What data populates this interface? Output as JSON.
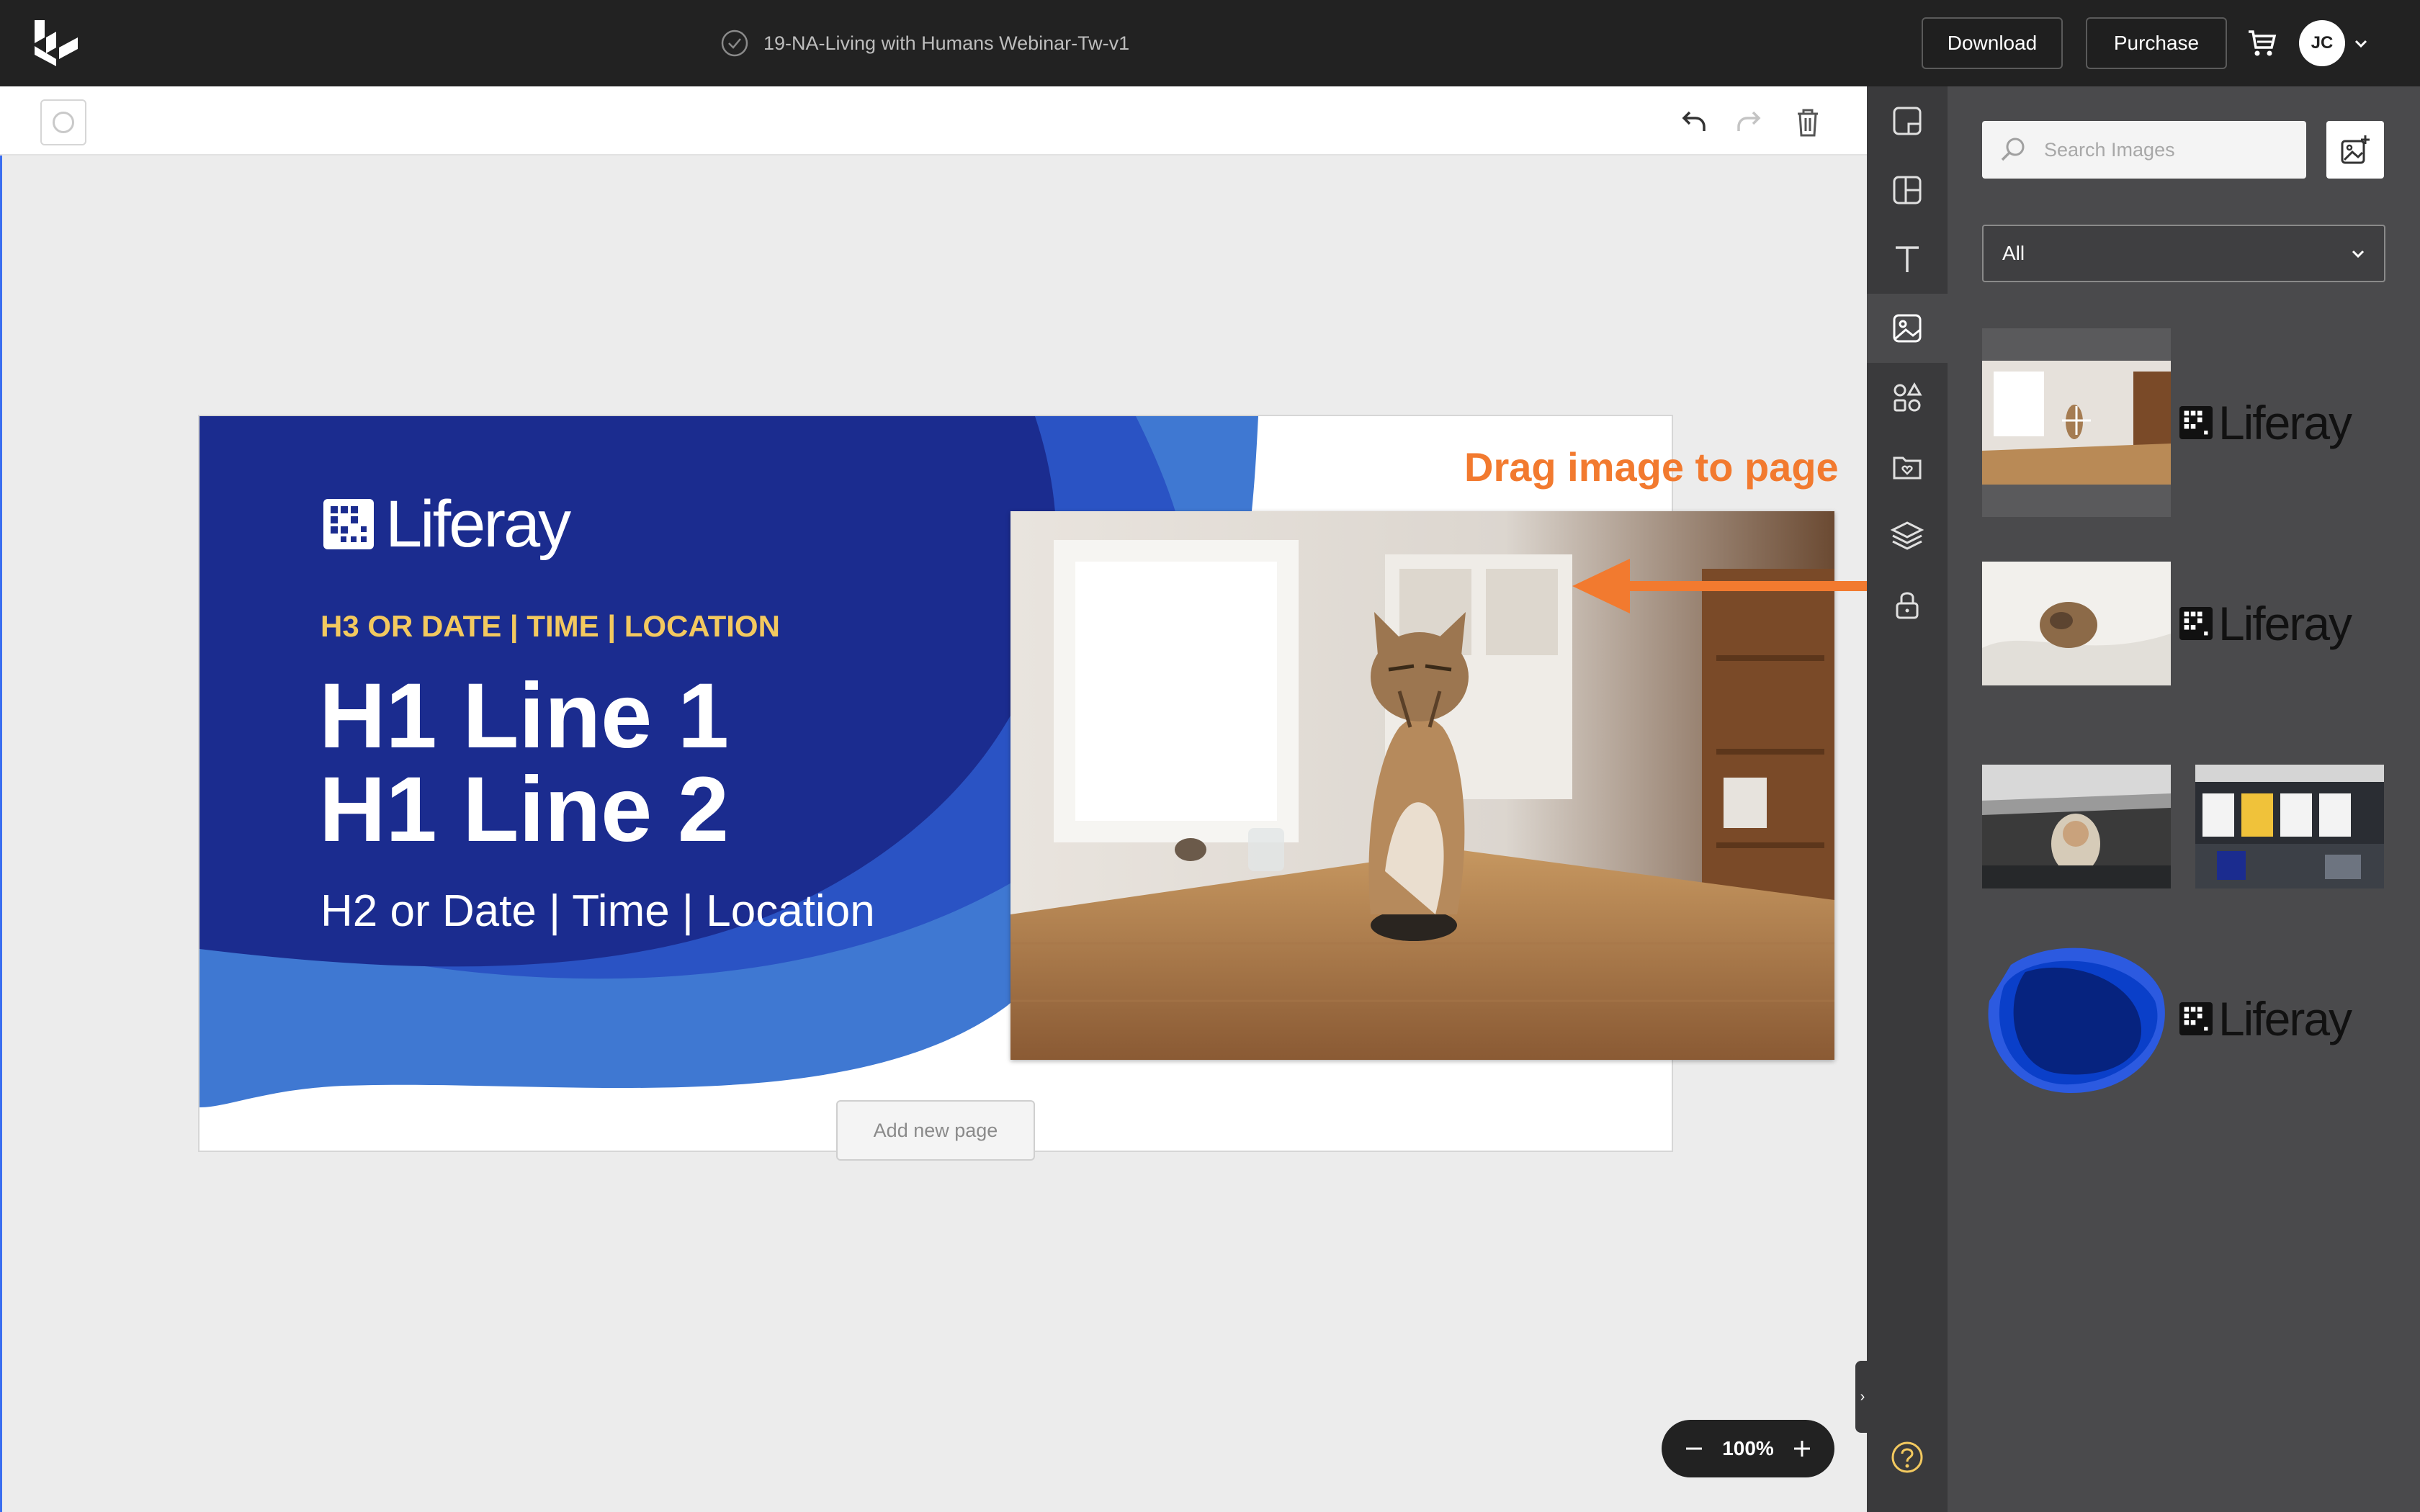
{
  "app": {
    "document_title": "19-NA-Living with Humans Webinar-Tw-v1",
    "download_label": "Download",
    "purchase_label": "Purchase",
    "user_initials": "JC"
  },
  "design": {
    "brand_name": "Liferay",
    "h3_text": "H3 OR DATE | TIME | LOCATION",
    "h1_line1": "H1 Line 1",
    "h1_line2": "H1 Line 2",
    "h2_text": "H2 or Date | Time | Location",
    "annotation": "Drag image to page"
  },
  "canvas": {
    "add_page_label": "Add new page",
    "zoom_level": "100%"
  },
  "images_panel": {
    "search_placeholder": "Search Images",
    "filter_selected": "All",
    "thumbnails": [
      {
        "name": "kitchen-cat",
        "label": ""
      },
      {
        "name": "liferay-logo",
        "label": "Liferay"
      },
      {
        "name": "sleeping-cat",
        "label": ""
      },
      {
        "name": "liferay-logo",
        "label": "Liferay"
      },
      {
        "name": "worker-overhead",
        "label": ""
      },
      {
        "name": "office-space",
        "label": ""
      },
      {
        "name": "blue-blob",
        "label": ""
      },
      {
        "name": "liferay-logo",
        "label": "Liferay"
      }
    ]
  },
  "colors": {
    "brand_blue": "#1b2c8f",
    "mid_blue": "#2f5bd0",
    "light_blue": "#4a7bd6",
    "accent_yellow": "#f3c95f",
    "annotation_orange": "#f27a2f",
    "topbar": "#222222"
  }
}
